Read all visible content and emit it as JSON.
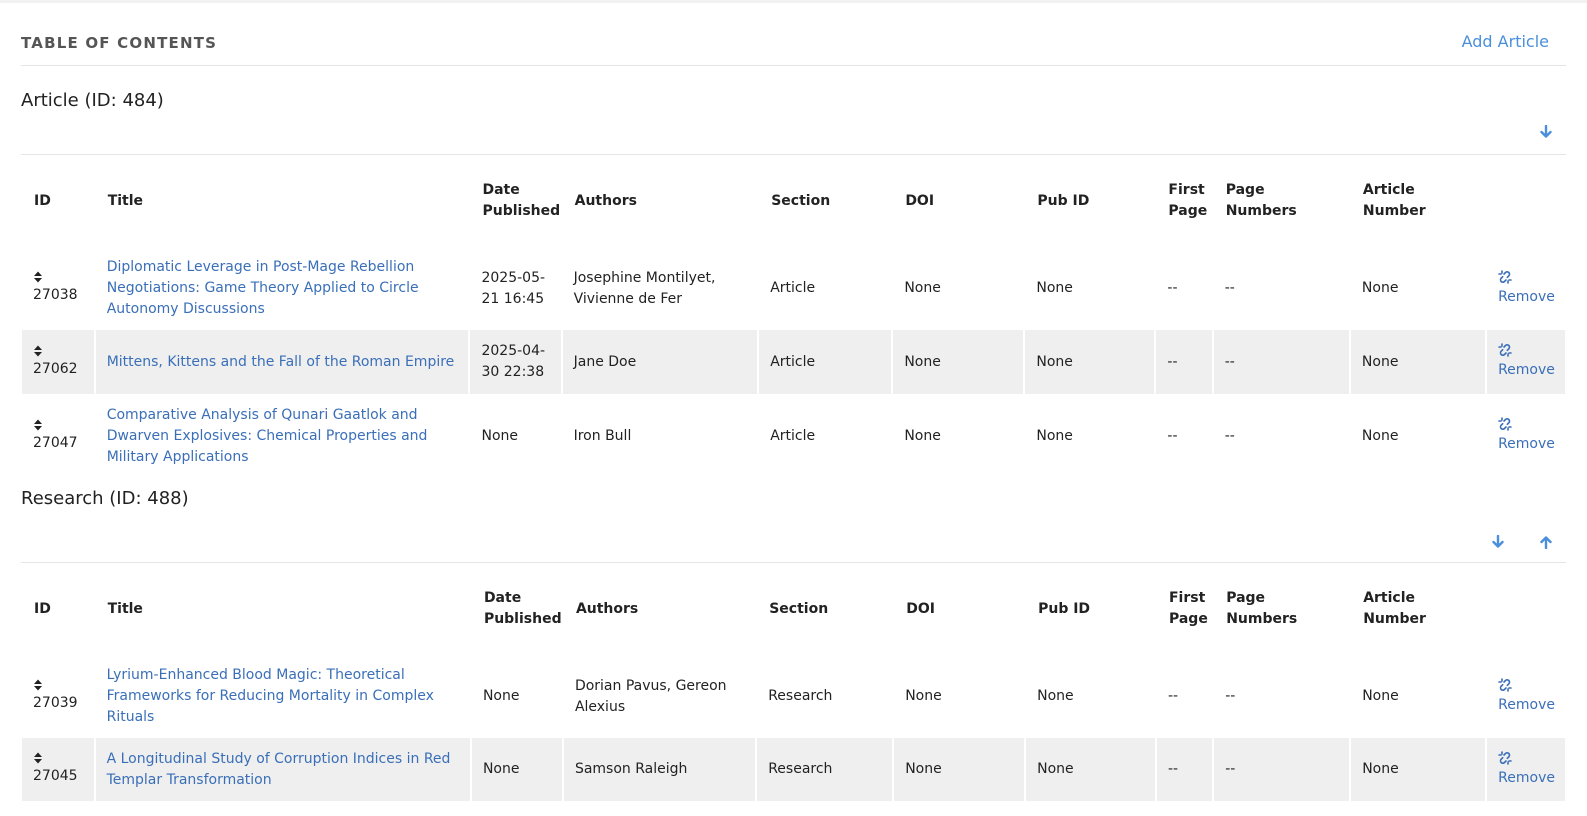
{
  "toc": {
    "title": "TABLE OF CONTENTS",
    "add_label": "Add Article"
  },
  "columns": {
    "id": "ID",
    "title": "Title",
    "date": "Date Published",
    "authors": "Authors",
    "section": "Section",
    "doi": "DOI",
    "pubid": "Pub ID",
    "first_page": "First Page",
    "page_numbers": "Page Numbers",
    "article_number": "Article Number"
  },
  "remove_label": "Remove",
  "icons": {
    "sort": "sort-icon",
    "unlink": "unlink-icon",
    "move_down": "arrow-down-icon",
    "move_up": "arrow-up-icon"
  },
  "colors": {
    "link": "#3a6fb8",
    "accent": "#4a8fdb",
    "row_shade": "#efefef"
  },
  "sections": [
    {
      "name": "Article (ID: 484)",
      "rows": [
        {
          "id": "27038",
          "title": "Diplomatic Leverage in Post-Mage Rebellion Negotiations: Game Theory Applied to Circle Autonomy Discussions",
          "date": "2025-05-21 16:45",
          "authors": "Josephine Montilyet, Vivienne de Fer",
          "section": "Article",
          "doi": "None",
          "pubid": "None",
          "first_page": "--",
          "page_numbers": "--",
          "article_number": "None"
        },
        {
          "id": "27062",
          "title": "Mittens, Kittens and the Fall of the Roman Empire",
          "date": "2025-04-30 22:38",
          "authors": "Jane Doe",
          "section": "Article",
          "doi": "None",
          "pubid": "None",
          "first_page": "--",
          "page_numbers": "--",
          "article_number": "None"
        },
        {
          "id": "27047",
          "title": "Comparative Analysis of Qunari Gaatlok and Dwarven Explosives: Chemical Properties and Military Applications",
          "date": "None",
          "authors": "Iron Bull",
          "section": "Article",
          "doi": "None",
          "pubid": "None",
          "first_page": "--",
          "page_numbers": "--",
          "article_number": "None"
        }
      ]
    },
    {
      "name": "Research (ID: 488)",
      "rows": [
        {
          "id": "27039",
          "title": "Lyrium-Enhanced Blood Magic: Theoretical Frameworks for Reducing Mortality in Complex Rituals",
          "date": "None",
          "authors": "Dorian Pavus, Gereon Alexius",
          "section": "Research",
          "doi": "None",
          "pubid": "None",
          "first_page": "--",
          "page_numbers": "--",
          "article_number": "None"
        },
        {
          "id": "27045",
          "title": "A Longitudinal Study of Corruption Indices in Red Templar Transformation",
          "date": "None",
          "authors": "Samson Raleigh",
          "section": "Research",
          "doi": "None",
          "pubid": "None",
          "first_page": "--",
          "page_numbers": "--",
          "article_number": "None"
        }
      ]
    }
  ]
}
